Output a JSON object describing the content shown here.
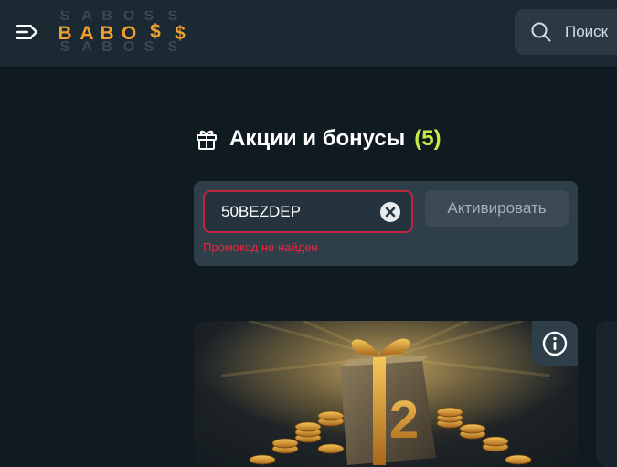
{
  "header": {
    "logo_text": "BABOSS",
    "search_label": "Поиск"
  },
  "promotions": {
    "title": "Акции и бонусы",
    "count": "(5)"
  },
  "promo_code": {
    "value": "50BEZDEP",
    "activate_label": "Активировать",
    "error_message": "Промокод не найден"
  },
  "promo_card": {
    "badge_number": "2"
  },
  "colors": {
    "accent_green": "#c7ea46",
    "error_red": "#e8263f",
    "logo_orange": "#f0a030"
  }
}
